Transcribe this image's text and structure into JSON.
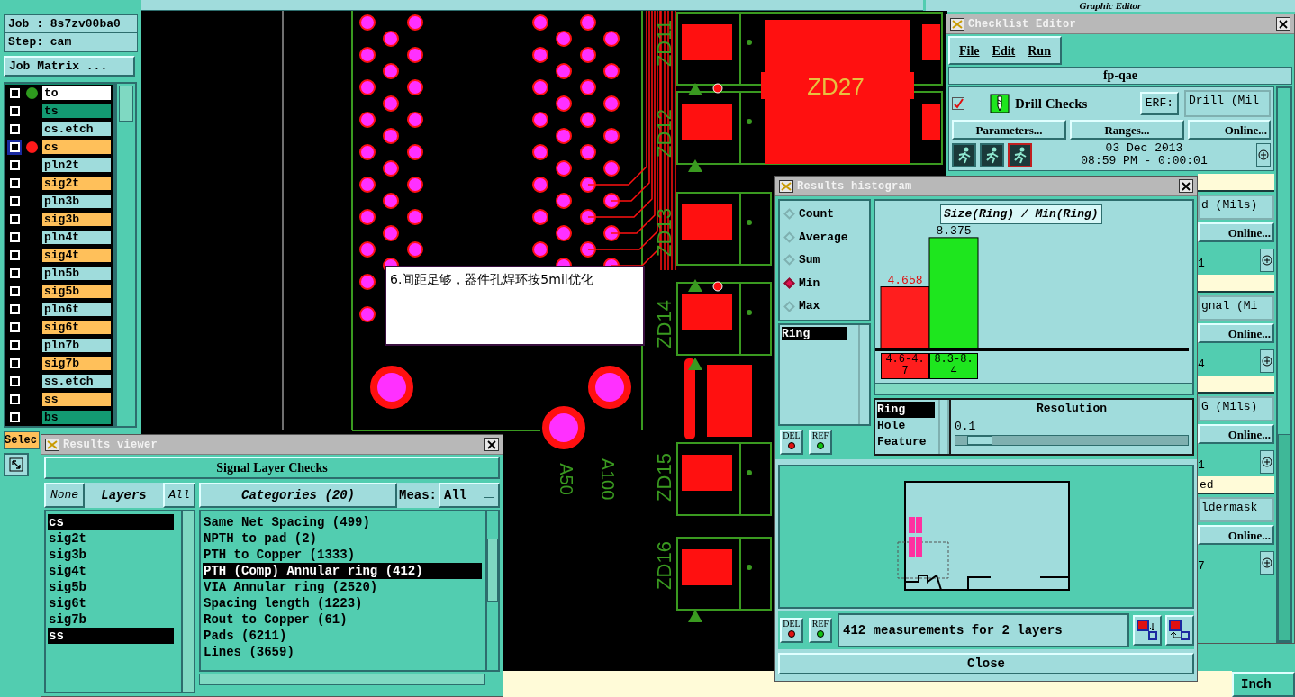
{
  "top_bar": {
    "title": "Graphic Editor"
  },
  "job": {
    "job": "Job : 8s7zv00ba0",
    "step": "Step: cam",
    "matrix_button": "Job Matrix ..."
  },
  "layers": [
    {
      "name": "to",
      "kind": "overlay",
      "color": "#2e9a1e",
      "selected": false
    },
    {
      "name": "ts",
      "kind": "mask",
      "selected": false
    },
    {
      "name": "cs.etch",
      "kind": "plane",
      "selected": false
    },
    {
      "name": "cs",
      "kind": "signal",
      "color": "#ff1a1a",
      "selected": true
    },
    {
      "name": "pln2t",
      "kind": "plane",
      "selected": false
    },
    {
      "name": "sig2t",
      "kind": "signal",
      "selected": false
    },
    {
      "name": "pln3b",
      "kind": "plane",
      "selected": false
    },
    {
      "name": "sig3b",
      "kind": "signal",
      "selected": false
    },
    {
      "name": "pln4t",
      "kind": "plane",
      "selected": false
    },
    {
      "name": "sig4t",
      "kind": "signal",
      "selected": false
    },
    {
      "name": "pln5b",
      "kind": "plane",
      "selected": false
    },
    {
      "name": "sig5b",
      "kind": "signal",
      "selected": false
    },
    {
      "name": "pln6t",
      "kind": "plane",
      "selected": false
    },
    {
      "name": "sig6t",
      "kind": "signal",
      "selected": false
    },
    {
      "name": "pln7b",
      "kind": "plane",
      "selected": false
    },
    {
      "name": "sig7b",
      "kind": "signal",
      "selected": false
    },
    {
      "name": "ss.etch",
      "kind": "plane",
      "selected": false
    },
    {
      "name": "ss",
      "kind": "signal",
      "selected": false
    },
    {
      "name": "bs",
      "kind": "mask",
      "selected": false
    }
  ],
  "select_label": "Selec",
  "canvas": {
    "note": "6.间距足够，器件孔焊环按5mil优化",
    "labels": [
      {
        "text": "ZD11"
      },
      {
        "text": "ZD12"
      },
      {
        "text": "ZD13"
      },
      {
        "text": "ZD14"
      },
      {
        "text": "ZD15"
      },
      {
        "text": "ZD16"
      },
      {
        "text": "ZD27"
      },
      {
        "text": "A50"
      },
      {
        "text": "A100"
      }
    ]
  },
  "results_viewer": {
    "title": "Results viewer",
    "header": "Signal Layer Checks",
    "none_button": "None",
    "layers_button": "Layers",
    "all_button": "All",
    "categories_button": "Categories (20)",
    "meas_label": "Meas:",
    "meas_value": "All",
    "layers": [
      {
        "name": "cs",
        "selected": true
      },
      {
        "name": "sig2t",
        "selected": false
      },
      {
        "name": "sig3b",
        "selected": false
      },
      {
        "name": "sig4t",
        "selected": false
      },
      {
        "name": "sig5b",
        "selected": false
      },
      {
        "name": "sig6t",
        "selected": false
      },
      {
        "name": "sig7b",
        "selected": false
      },
      {
        "name": "ss",
        "selected": true
      }
    ],
    "categories": [
      {
        "name": "Same Net Spacing (499)",
        "selected": false
      },
      {
        "name": "NPTH to pad (2)",
        "selected": false
      },
      {
        "name": "PTH to Copper (1333)",
        "selected": false
      },
      {
        "name": "PTH (Comp) Annular ring (412)",
        "selected": true
      },
      {
        "name": "VIA Annular ring (2520)",
        "selected": false
      },
      {
        "name": "Spacing length (1223)",
        "selected": false
      },
      {
        "name": "Rout to Copper (61)",
        "selected": false
      },
      {
        "name": "Pads (6211)",
        "selected": false
      },
      {
        "name": "Lines (3659)",
        "selected": false
      }
    ]
  },
  "histogram": {
    "title": "Results histogram",
    "modes": [
      {
        "label": "Count",
        "selected": false
      },
      {
        "label": "Average",
        "selected": false
      },
      {
        "label": "Sum",
        "selected": false
      },
      {
        "label": "Min",
        "selected": true
      },
      {
        "label": "Max",
        "selected": false
      }
    ],
    "attributes": [
      {
        "name": "Ring",
        "selected": true
      }
    ],
    "list_buttons": [
      "DEL",
      "REF"
    ],
    "chart_data": {
      "type": "bar",
      "title": "Size(Ring) / Min(Ring)",
      "categories": [
        "4.6-4.7",
        "8.3-8.4"
      ],
      "stacked": true,
      "data_labels": true,
      "series": [
        {
          "color": "#ff1e1e",
          "values": [
            4.658,
            null
          ]
        },
        {
          "color": "#1ee61e",
          "values": [
            null,
            8.375
          ]
        }
      ]
    },
    "keys": [
      {
        "name": "Ring",
        "selected": true
      },
      {
        "name": "Hole",
        "selected": false
      },
      {
        "name": "Feature",
        "selected": false
      }
    ],
    "resolution": {
      "label": "Resolution",
      "value": "0.1",
      "level": 0.05
    },
    "preview_buttons": [
      "DEL",
      "REF"
    ],
    "summary": "412 measurements for 2 layers",
    "close_button": "Close"
  },
  "checklist_editor": {
    "title": "Checklist Editor",
    "menus": [
      "File",
      "Edit",
      "Run"
    ],
    "checklist_name": "fp-qae",
    "check": {
      "checked": true,
      "name": "Drill Checks",
      "erf_label": "ERF:",
      "erf_value": "Drill (Mil",
      "buttons": [
        "Parameters...",
        "Ranges...",
        "Online..."
      ],
      "date": "03 Dec 2013",
      "time": "08:59 PM - 0:00:01"
    },
    "partial_items": [
      {
        "kind": "status"
      },
      {
        "kind": "field",
        "text": "d (Mils)"
      },
      {
        "kind": "online",
        "text": "Online..."
      },
      {
        "kind": "count",
        "text": "1"
      },
      {
        "kind": "status"
      },
      {
        "kind": "field",
        "text": "gnal (Mi"
      },
      {
        "kind": "online",
        "text": "Online..."
      },
      {
        "kind": "count",
        "text": "4"
      },
      {
        "kind": "status"
      },
      {
        "kind": "field",
        "text": "G (Mils)"
      },
      {
        "kind": "online",
        "text": "Online..."
      },
      {
        "kind": "count",
        "text": "1"
      },
      {
        "kind": "status",
        "text": "ed"
      },
      {
        "kind": "field",
        "text": "ldermask"
      },
      {
        "kind": "online",
        "text": "Online..."
      },
      {
        "kind": "count",
        "text": "7"
      }
    ],
    "units": "Inch"
  }
}
